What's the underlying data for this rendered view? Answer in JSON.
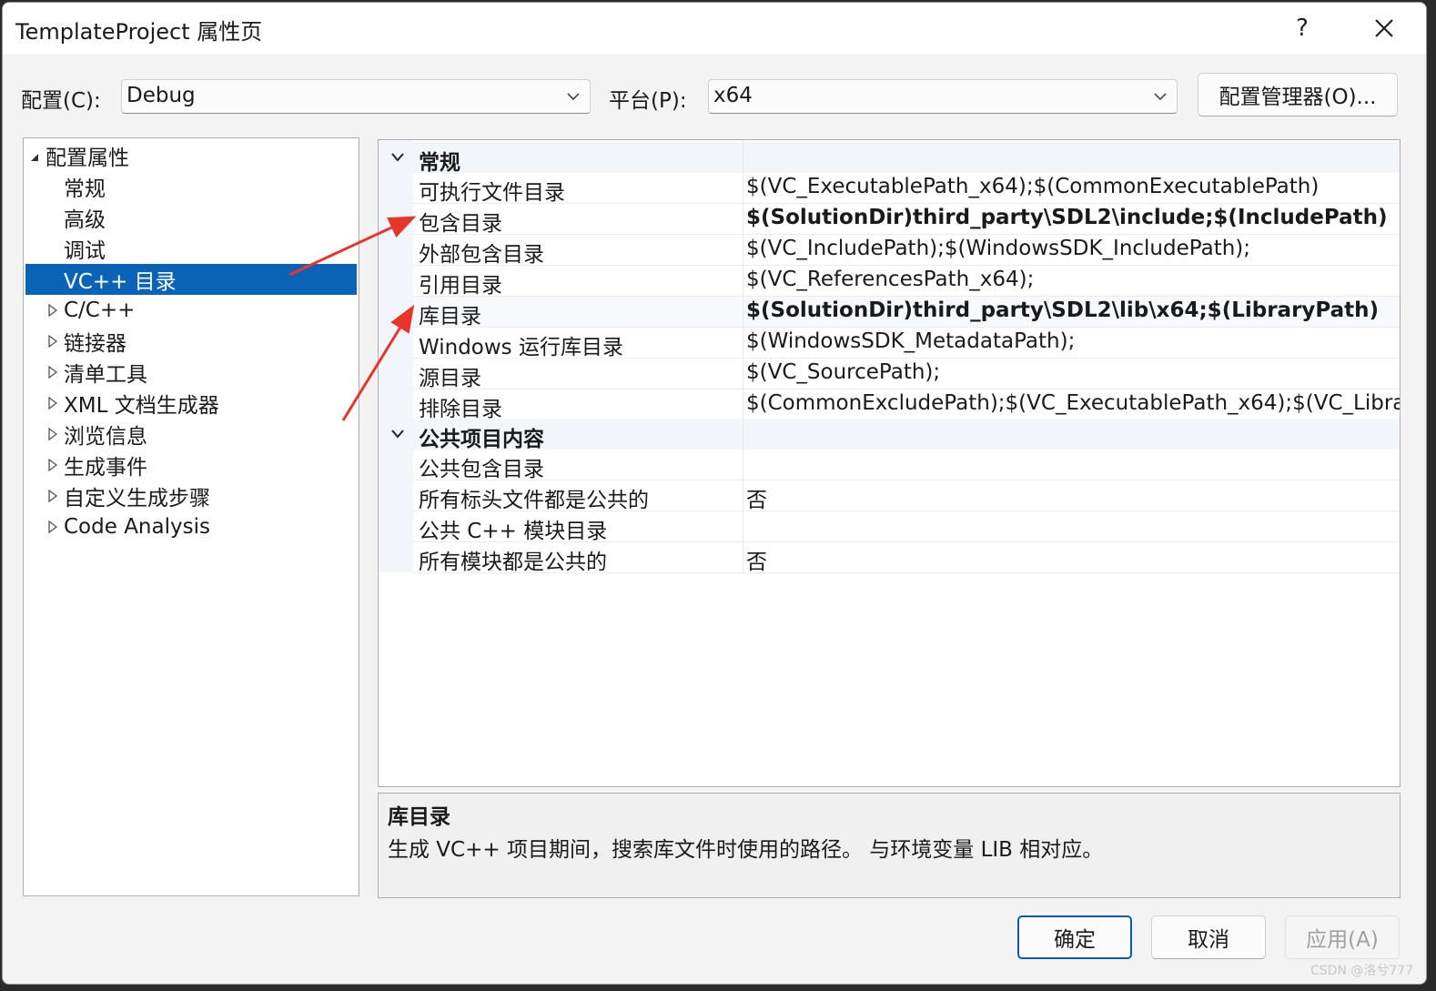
{
  "window": {
    "title": "TemplateProject 属性页",
    "help_label": "?"
  },
  "config_bar": {
    "config_label": "配置(C):",
    "config_value": "Debug",
    "platform_label": "平台(P):",
    "platform_value": "x64",
    "manager_button": "配置管理器(O)..."
  },
  "tree": {
    "root": "配置属性",
    "items": [
      {
        "label": "常规",
        "expandable": false
      },
      {
        "label": "高级",
        "expandable": false
      },
      {
        "label": "调试",
        "expandable": false
      },
      {
        "label": "VC++ 目录",
        "expandable": false,
        "selected": true
      },
      {
        "label": "C/C++",
        "expandable": true
      },
      {
        "label": "链接器",
        "expandable": true
      },
      {
        "label": "清单工具",
        "expandable": true
      },
      {
        "label": "XML 文档生成器",
        "expandable": true
      },
      {
        "label": "浏览信息",
        "expandable": true
      },
      {
        "label": "生成事件",
        "expandable": true
      },
      {
        "label": "自定义生成步骤",
        "expandable": true
      },
      {
        "label": "Code Analysis",
        "expandable": true
      }
    ]
  },
  "grid": {
    "categories": [
      {
        "label": "常规",
        "props": [
          {
            "name": "可执行文件目录",
            "value": "$(VC_ExecutablePath_x64);$(CommonExecutablePath)",
            "bold": false
          },
          {
            "name": "包含目录",
            "value": "$(SolutionDir)third_party\\SDL2\\include;$(IncludePath)",
            "bold": true
          },
          {
            "name": "外部包含目录",
            "value": "$(VC_IncludePath);$(WindowsSDK_IncludePath);",
            "bold": false
          },
          {
            "name": "引用目录",
            "value": "$(VC_ReferencesPath_x64);",
            "bold": false
          },
          {
            "name": "库目录",
            "value": "$(SolutionDir)third_party\\SDL2\\lib\\x64;$(LibraryPath)",
            "bold": true
          },
          {
            "name": "Windows 运行库目录",
            "value": "$(WindowsSDK_MetadataPath);",
            "bold": false
          },
          {
            "name": "源目录",
            "value": "$(VC_SourcePath);",
            "bold": false
          },
          {
            "name": "排除目录",
            "value": "$(CommonExcludePath);$(VC_ExecutablePath_x64);$(VC_Library",
            "bold": false
          }
        ]
      },
      {
        "label": "公共项目内容",
        "props": [
          {
            "name": "公共包含目录",
            "value": "",
            "bold": false
          },
          {
            "name": "所有标头文件都是公共的",
            "value": "否",
            "bold": false
          },
          {
            "name": "公共 C++ 模块目录",
            "value": "",
            "bold": false
          },
          {
            "name": "所有模块都是公共的",
            "value": "否",
            "bold": false
          }
        ]
      }
    ]
  },
  "description": {
    "title": "库目录",
    "text": "生成 VC++ 项目期间，搜索库文件时使用的路径。 与环境变量 LIB 相对应。"
  },
  "buttons": {
    "ok": "确定",
    "cancel": "取消",
    "apply": "应用(A)"
  },
  "watermark": "CSDN @洛兮777",
  "colors": {
    "selection": "#0b63b8",
    "annotation_arrow": "#e8352b",
    "primary_border": "#0b5ba8"
  }
}
